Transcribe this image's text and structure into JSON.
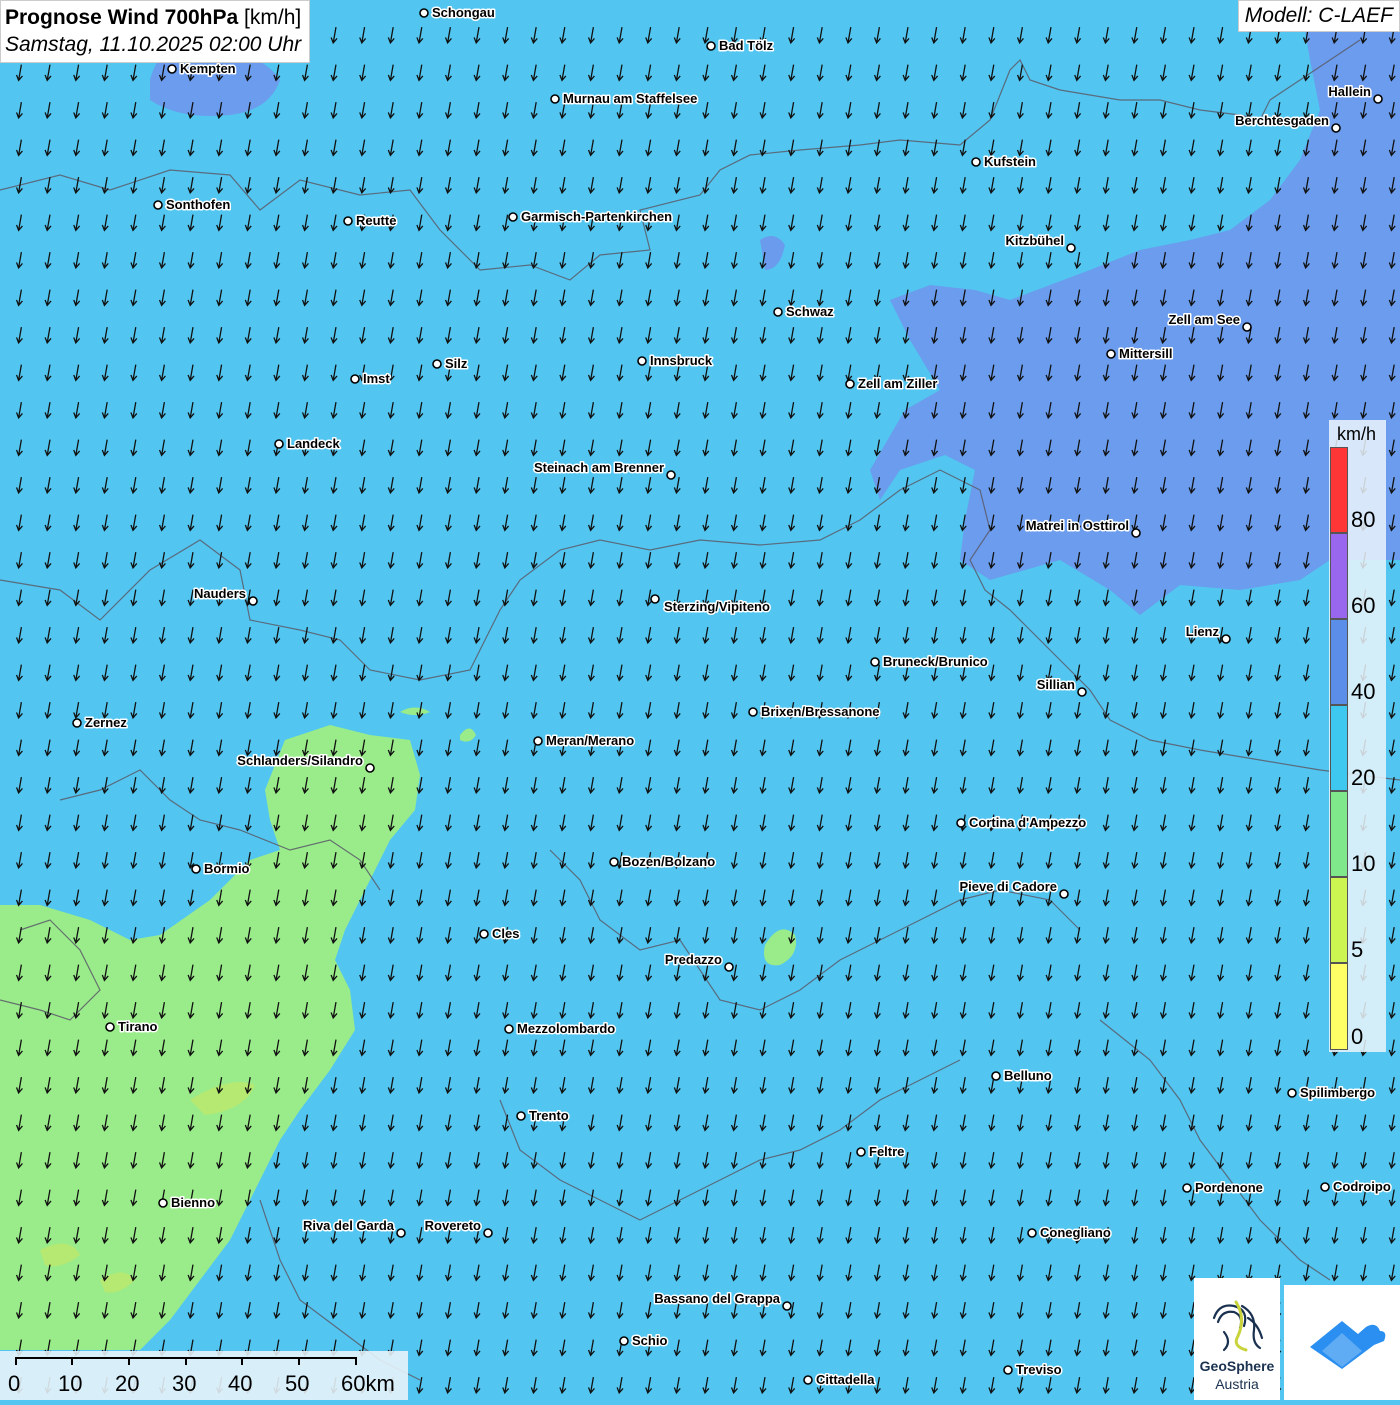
{
  "title": {
    "main": "Prognose Wind 700hPa",
    "unit": "[km/h]",
    "datetime": "Samstag, 11.10.2025 02:00 Uhr"
  },
  "model": "Modell: C-LAEF",
  "legend": {
    "unit": "km/h",
    "labels": [
      "80",
      "60",
      "40",
      "20",
      "10",
      "5",
      "0"
    ],
    "colors": [
      "#ff3636",
      "#9966ee",
      "#5b8ee8",
      "#3ec8f0",
      "#7ee88a",
      "#cdf552",
      "#ffff66"
    ]
  },
  "scale": {
    "labels": [
      "0",
      "10",
      "20",
      "30",
      "40",
      "50",
      "60km"
    ]
  },
  "wind_field": {
    "direction": "north",
    "colors": {
      "base": "#52c6f0",
      "strong": "#6e97ec",
      "weak": "#9aec8a",
      "very_weak": "#bde86a"
    }
  },
  "cities": [
    {
      "name": "Schongau",
      "pos": [
        424,
        13
      ],
      "anchor": "right"
    },
    {
      "name": "Bad Tölz",
      "pos": [
        711,
        46
      ],
      "anchor": "right"
    },
    {
      "name": "Kempten",
      "pos": [
        172,
        69
      ],
      "anchor": "right"
    },
    {
      "name": "Murnau am Staffelsee",
      "pos": [
        555,
        99
      ],
      "anchor": "right"
    },
    {
      "name": "Hallein",
      "pos": [
        1378,
        99
      ],
      "anchor": "left"
    },
    {
      "name": "Berchtesgaden",
      "pos": [
        1336,
        128
      ],
      "anchor": "left"
    },
    {
      "name": "Kufstein",
      "pos": [
        976,
        162
      ],
      "anchor": "right"
    },
    {
      "name": "Sonthofen",
      "pos": [
        158,
        205
      ],
      "anchor": "right"
    },
    {
      "name": "Garmisch-Partenkirchen",
      "pos": [
        513,
        217
      ],
      "anchor": "right"
    },
    {
      "name": "Reutte",
      "pos": [
        348,
        221
      ],
      "anchor": "right"
    },
    {
      "name": "Kitzbühel",
      "pos": [
        1071,
        248
      ],
      "anchor": "left"
    },
    {
      "name": "Schwaz",
      "pos": [
        778,
        312
      ],
      "anchor": "right"
    },
    {
      "name": "Zell am See",
      "pos": [
        1247,
        327
      ],
      "anchor": "left"
    },
    {
      "name": "Mittersill",
      "pos": [
        1111,
        354
      ],
      "anchor": "right"
    },
    {
      "name": "Innsbruck",
      "pos": [
        642,
        361
      ],
      "anchor": "right"
    },
    {
      "name": "Silz",
      "pos": [
        437,
        364
      ],
      "anchor": "right"
    },
    {
      "name": "Imst",
      "pos": [
        355,
        379
      ],
      "anchor": "right"
    },
    {
      "name": "Zell am Ziller",
      "pos": [
        850,
        384
      ],
      "anchor": "right"
    },
    {
      "name": "Landeck",
      "pos": [
        279,
        444
      ],
      "anchor": "right"
    },
    {
      "name": "Steinach am Brenner",
      "pos": [
        671,
        475
      ],
      "anchor": "left"
    },
    {
      "name": "Matrei in Osttirol",
      "pos": [
        1136,
        533
      ],
      "anchor": "left"
    },
    {
      "name": "Nauders",
      "pos": [
        253,
        601
      ],
      "anchor": "left"
    },
    {
      "name": "Sterzing/Vipiteno",
      "pos": [
        655,
        599
      ],
      "anchor": "below"
    },
    {
      "name": "Lienz",
      "pos": [
        1226,
        639
      ],
      "anchor": "left"
    },
    {
      "name": "Bruneck/Brunico",
      "pos": [
        875,
        662
      ],
      "anchor": "right"
    },
    {
      "name": "Sillian",
      "pos": [
        1082,
        692
      ],
      "anchor": "left"
    },
    {
      "name": "Brixen/Bressanone",
      "pos": [
        753,
        712
      ],
      "anchor": "right"
    },
    {
      "name": "Zernez",
      "pos": [
        77,
        723
      ],
      "anchor": "right"
    },
    {
      "name": "Meran/Merano",
      "pos": [
        538,
        741
      ],
      "anchor": "right"
    },
    {
      "name": "Schlanders/Silandro",
      "pos": [
        370,
        768
      ],
      "anchor": "left"
    },
    {
      "name": "Cortina d'Ampezzo",
      "pos": [
        961,
        823
      ],
      "anchor": "right"
    },
    {
      "name": "Bozen/Bolzano",
      "pos": [
        614,
        862
      ],
      "anchor": "right"
    },
    {
      "name": "Bormio",
      "pos": [
        196,
        869
      ],
      "anchor": "right"
    },
    {
      "name": "Pieve di Cadore",
      "pos": [
        1064,
        894
      ],
      "anchor": "left"
    },
    {
      "name": "Cles",
      "pos": [
        484,
        934
      ],
      "anchor": "right"
    },
    {
      "name": "Predazzo",
      "pos": [
        729,
        967
      ],
      "anchor": "left"
    },
    {
      "name": "Tirano",
      "pos": [
        110,
        1027
      ],
      "anchor": "right"
    },
    {
      "name": "Mezzolombardo",
      "pos": [
        509,
        1029
      ],
      "anchor": "right"
    },
    {
      "name": "Belluno",
      "pos": [
        996,
        1076
      ],
      "anchor": "right"
    },
    {
      "name": "Spilimbergo",
      "pos": [
        1292,
        1093
      ],
      "anchor": "right"
    },
    {
      "name": "Trento",
      "pos": [
        521,
        1116
      ],
      "anchor": "right"
    },
    {
      "name": "Feltre",
      "pos": [
        861,
        1152
      ],
      "anchor": "right"
    },
    {
      "name": "Pordenone",
      "pos": [
        1187,
        1188
      ],
      "anchor": "right"
    },
    {
      "name": "Codroipo",
      "pos": [
        1325,
        1187
      ],
      "anchor": "right"
    },
    {
      "name": "Bienno",
      "pos": [
        163,
        1203
      ],
      "anchor": "right"
    },
    {
      "name": "Riva del Garda",
      "pos": [
        401,
        1233
      ],
      "anchor": "left"
    },
    {
      "name": "Rovereto",
      "pos": [
        488,
        1233
      ],
      "anchor": "left"
    },
    {
      "name": "Conegliano",
      "pos": [
        1032,
        1233
      ],
      "anchor": "right"
    },
    {
      "name": "Bassano del Grappa",
      "pos": [
        787,
        1306
      ],
      "anchor": "left"
    },
    {
      "name": "Schio",
      "pos": [
        624,
        1341
      ],
      "anchor": "right"
    },
    {
      "name": "Treviso",
      "pos": [
        1008,
        1370
      ],
      "anchor": "right"
    },
    {
      "name": "Cittadella",
      "pos": [
        808,
        1380
      ],
      "anchor": "right"
    }
  ],
  "logos": {
    "geosphere_line1": "GeoSphere",
    "geosphere_line2": "Austria"
  }
}
